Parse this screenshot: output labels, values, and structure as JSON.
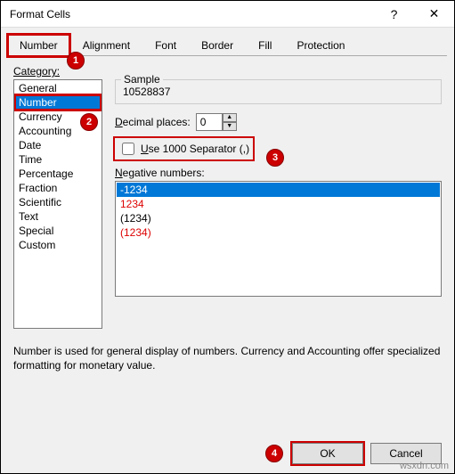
{
  "title": "Format Cells",
  "tabs": [
    "Number",
    "Alignment",
    "Font",
    "Border",
    "Fill",
    "Protection"
  ],
  "category_label": "Category:",
  "categories": [
    "General",
    "Number",
    "Currency",
    "Accounting",
    "Date",
    "Time",
    "Percentage",
    "Fraction",
    "Scientific",
    "Text",
    "Special",
    "Custom"
  ],
  "selected_category": "Number",
  "sample_label": "Sample",
  "sample_value": "10528837",
  "decimal_label": "Decimal places:",
  "decimal_value": "0",
  "separator_label": "Use 1000 Separator (,)",
  "negative_label": "Negative numbers:",
  "negatives": [
    {
      "text": "-1234",
      "red": false,
      "sel": true
    },
    {
      "text": "1234",
      "red": true,
      "sel": false
    },
    {
      "text": "(1234)",
      "red": false,
      "sel": false
    },
    {
      "text": "(1234)",
      "red": true,
      "sel": false
    }
  ],
  "description": "Number is used for general display of numbers.  Currency and Accounting offer specialized formatting for monetary value.",
  "ok": "OK",
  "cancel": "Cancel",
  "watermark": "wsxdn.com",
  "callouts": {
    "c1": "1",
    "c2": "2",
    "c3": "3",
    "c4": "4"
  }
}
